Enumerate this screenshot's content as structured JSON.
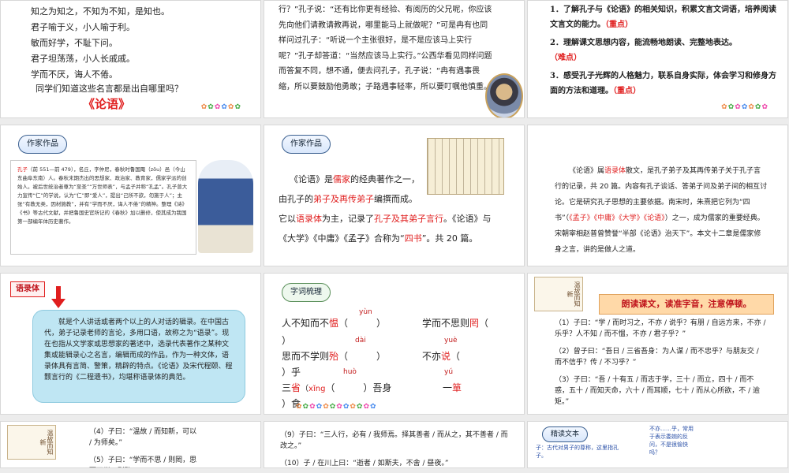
{
  "slides": {
    "s1": {
      "lines": [
        "知之为知之，不知为不知，是知也。",
        "君子喻于义，小人喻于利。",
        "敏而好学，不耻下问。",
        "君子坦荡荡，小人长戚戚。",
        "学而不厌，诲人不倦。"
      ],
      "question": "同学们知道这些名言都是出自哪里吗？",
      "title": "《论语》"
    },
    "s2": {
      "text": "行？”孔子说：“还有比你更有经验、有阅历的父兄呢，你应该先向他们请教请教再说，哪里能马上就做呢？”可是冉有也同样问过孔子：“听说一个主张很好，是不是应该马上实行呢？”孔子却答道：“当然应该马上实行。”公西华看见同样问题而答复不同，想不通，便去问孔子，孔子说：“冉有遇事畏缩，所以要鼓励他勇敢；子路遇事轻率，所以要叮嘱他慎重。”"
    },
    "s3": {
      "goal1": "1．了解孔子与《论语》的相关知识，积累文言文词语，培养阅读文言文的能力。",
      "goal1_tag": "（重点）",
      "goal2": "2．理解课文思想内容，能流畅地朗读、完整地表达。",
      "goal2_tag": "（难点）",
      "goal3": "3．感受孔子光辉的人格魅力，联系自身实际，体会学习和修身方面的方法和道理。",
      "goal3_tag": "（重点）"
    },
    "s4": {
      "tag": "作家作品",
      "bio_name": "孔子",
      "bio": "（前 551—前 479），名丘，字仲尼，春秋时鲁国陬（zōu）邑（今山东曲阜东南）人。春秋末期杰出的思想家、政治家、教育家，儒家学派的创始人。被后世统治者尊为“至圣”“万世师表”，与孟子并称“孔孟”。孔子曾大力宣传“仁”的学说，认为“仁”即“爱人”，提出“己所不欲，勿施于人”；主张“有教无类，因材施教”，并有“学而不厌，诲人不倦”的精神。整理《诗》《书》等古代文献，并把鲁国史官所记的《春秋》加以删修，使其成为我国第一部编年体历史著作。"
    },
    "s5": {
      "tag": "作家作品",
      "p1a": "《论语》是",
      "p1b": "儒家",
      "p1c": "的经典著作之一，",
      "p2a": "由孔子的",
      "p2b": "弟子及再传弟子",
      "p2c": "编撰而成。",
      "p3a": "它以",
      "p3b": "语录体",
      "p3c": "为主，记录了",
      "p3d": "孔子及其弟子言行",
      "p3e": "。《论语》与",
      "p4a": "《大学》《中庸》《孟子》合称为“",
      "p4b": "四书",
      "p4c": "”。共 20 篇。"
    },
    "s6": {
      "a": "《论语》属",
      "b": "语录体",
      "c": "散文，是孔子弟子及其再传弟子关于孔子言行的记录，共 20 篇。内容有孔子谈话、答弟子问及弟子间的相互讨论。它是研究孔子思想的主要依据。南宋时，朱熹把它列为“四书”（",
      "d": "《孟子》《中庸》《大学》《论语》",
      "e": "）之一，成为儒家的重要经典。宋朝宰相赵普曾赞誉“半部《论语》治天下”。本文十二章是儒家修身之言，讲的是做人之道。"
    },
    "s7": {
      "tag": "语录体",
      "text": "就是个人讲话或者两个以上的人对话的辑录。在中国古代，弟子记录老师的言论，多用口语，故称之为“语录”。现在也指从文学家或思想家的著述中，选录代表著作之某种文集或能辑录心之名言，编辑而成的作品，作为一种文体，语录体具有言简、警策，精辟的特点。《论语》及宋代程颐、程颢言行的《二程遗书》，均堪称语录体的典范。"
    },
    "s8": {
      "tag": "字词梳理",
      "r1a": "人不知而不",
      "r1a_hl": "愠",
      "r1a_py": "yùn",
      "r1a_end": "（　　　）",
      "r1b": "学而不思则",
      "r1b_hl": "罔",
      "r1b_end": "（",
      "r1b_close": "）",
      "r2a_py": "dài",
      "r2b_py": "yuè",
      "r2a": "思而不学则",
      "r2a_hl": "殆",
      "r2a_end": "（　　　）",
      "r2b": "不亦",
      "r2b_hl": "说",
      "r2b_end": "（",
      "r2b_tail": "）乎",
      "r3a_py": "huò",
      "r3b_py": "yú",
      "r3a": "三",
      "r3a_hl": "省",
      "r3a_py2": "xǐng",
      "r3a_end": "（　　　）吾身",
      "r3b": "一",
      "r3b_hl": "箪",
      "r3b_tail": "）食"
    },
    "s9": {
      "deco": "温故而知新",
      "banner": "朗读课文，读准字音，注意停顿。",
      "l1": "（1）子曰：“学 / 而时习之，不亦 / 说乎？有朋 / 自远方来，不亦 / 乐乎？人不知 / 而不愠，不亦 / 君子乎？”",
      "l2": "（2）曾子曰：“吾日 / 三省吾身：为人谋 / 而不忠乎？与朋友交 / 而不信乎？传 / 不习乎？”",
      "l3": "（3）子曰：“吾 / 十有五 / 而志于学，三十 / 而立，四十 / 而不惑，五十 / 而知天命，六十 / 而耳顺，七十 / 而从心所欲，不 / 逾矩。”"
    },
    "s10": {
      "deco": "温故而知新",
      "l1": "（4）子曰：“温故 / 而知新，可以 / 为师矣。”",
      "l2": "（5）子曰：“学而不思 / 则罔，思而不学 / 则殆。”"
    },
    "s11": {
      "l1": "（9）子曰：“三人行，必有 / 我师焉。择其善者 / 而从之，其不善者 / 而改之。”",
      "l2": "（10）子 / 在川上曰：“逝者 / 如斯夫，不舍 / 昼夜。”"
    },
    "s12": {
      "tag": "精读文本",
      "note1": "子：古代对男子的尊称，这里指孔子。",
      "note2": "不亦……乎，常用于表示委婉的反问，不是很愉快吗？"
    }
  },
  "colors": {
    "accent": "#e01e1e",
    "tag_border": "#3a5f8f",
    "box_blue": "#bfe6f3",
    "banner": "#ffd9a8"
  }
}
